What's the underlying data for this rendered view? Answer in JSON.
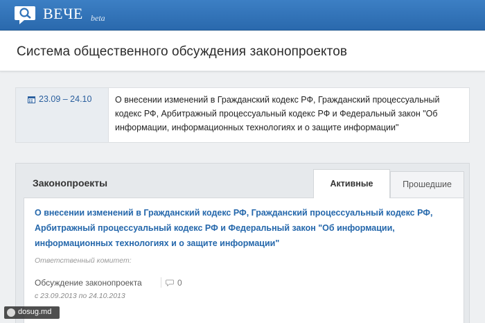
{
  "app": {
    "logo_text": "ВЕЧЕ",
    "logo_badge": "beta"
  },
  "header": {
    "title": "Система общественного обсуждения законопроектов"
  },
  "featured": {
    "date_range": "23.09 – 24.10",
    "text": "О внесении изменений в Гражданский кодекс РФ, Гражданский процессуальный кодекс РФ, Арбитражный процессуальный кодекс РФ и Федеральный закон \"Об информации, информационных технологиях и о защите информации\""
  },
  "bills": {
    "section_title": "Законопроекты",
    "tabs": [
      {
        "label": "Активные",
        "active": true
      },
      {
        "label": "Прошедшие",
        "active": false
      }
    ],
    "item": {
      "title": "О внесении изменений в Гражданский кодекс РФ, Гражданский процессуальный кодекс РФ, Арбитражный процессуальный кодекс РФ и Федеральный закон \"Об информации, информационных технологиях и о защите информации\"",
      "committee_label": "Ответственный комитет:",
      "status": "Обсуждение законопроекта",
      "comment_count": "0",
      "period": "с 23.09.2013 по 24.10.2013"
    }
  },
  "watermark": {
    "text": "dosug.md"
  },
  "colors": {
    "topbar": "#2f72b8",
    "link": "#2467ab",
    "date": "#2a5f9e"
  },
  "icons": {
    "logo": "speech-bubble-logo-icon",
    "calendar": "calendar-icon",
    "comment": "comment-icon"
  }
}
